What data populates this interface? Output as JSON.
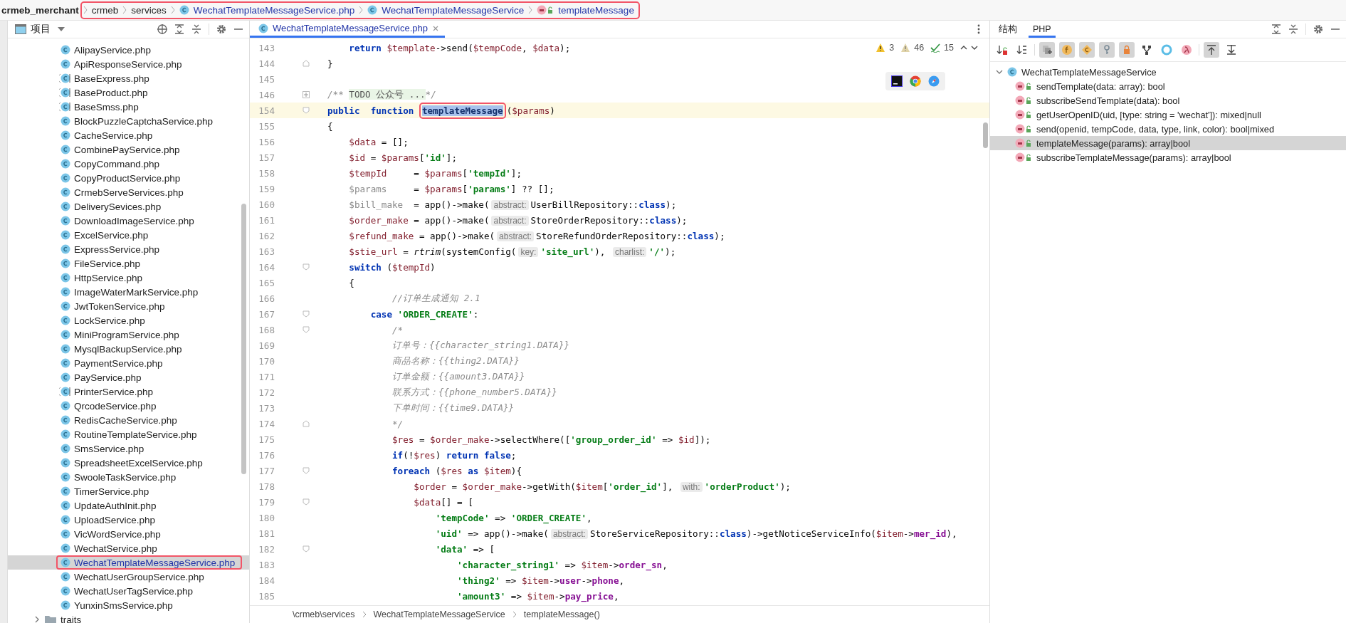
{
  "breadcrumb": {
    "project": "crmeb_merchant",
    "framed": true,
    "items": [
      {
        "label": "crmeb",
        "kind": "folder"
      },
      {
        "label": "services",
        "kind": "folder"
      },
      {
        "label": "WechatTemplateMessageService.php",
        "kind": "file"
      },
      {
        "label": "WechatTemplateMessageService",
        "kind": "class"
      },
      {
        "label": "templateMessage",
        "kind": "method"
      }
    ]
  },
  "project_panel": {
    "title": "项目",
    "files": [
      {
        "label": "AlipayService.php",
        "kind": "class",
        "selected": false,
        "annotated": false
      },
      {
        "label": "ApiResponseService.php",
        "kind": "class",
        "selected": false,
        "annotated": false
      },
      {
        "label": "BaseExpress.php",
        "kind": "abstract",
        "selected": false,
        "annotated": false
      },
      {
        "label": "BaseProduct.php",
        "kind": "abstract",
        "selected": false,
        "annotated": false
      },
      {
        "label": "BaseSmss.php",
        "kind": "abstract",
        "selected": false,
        "annotated": false
      },
      {
        "label": "BlockPuzzleCaptchaService.php",
        "kind": "class",
        "selected": false,
        "annotated": false
      },
      {
        "label": "CacheService.php",
        "kind": "class",
        "selected": false,
        "annotated": false
      },
      {
        "label": "CombinePayService.php",
        "kind": "class",
        "selected": false,
        "annotated": false
      },
      {
        "label": "CopyCommand.php",
        "kind": "class",
        "selected": false,
        "annotated": false
      },
      {
        "label": "CopyProductService.php",
        "kind": "class",
        "selected": false,
        "annotated": false
      },
      {
        "label": "CrmebServeServices.php",
        "kind": "class",
        "selected": false,
        "annotated": false
      },
      {
        "label": "DeliverySevices.php",
        "kind": "class",
        "selected": false,
        "annotated": false
      },
      {
        "label": "DownloadImageService.php",
        "kind": "class",
        "selected": false,
        "annotated": false
      },
      {
        "label": "ExcelService.php",
        "kind": "class",
        "selected": false,
        "annotated": false
      },
      {
        "label": "ExpressService.php",
        "kind": "class",
        "selected": false,
        "annotated": false
      },
      {
        "label": "FileService.php",
        "kind": "class",
        "selected": false,
        "annotated": false
      },
      {
        "label": "HttpService.php",
        "kind": "class",
        "selected": false,
        "annotated": false
      },
      {
        "label": "ImageWaterMarkService.php",
        "kind": "class",
        "selected": false,
        "annotated": false
      },
      {
        "label": "JwtTokenService.php",
        "kind": "class",
        "selected": false,
        "annotated": false
      },
      {
        "label": "LockService.php",
        "kind": "class",
        "selected": false,
        "annotated": false
      },
      {
        "label": "MiniProgramService.php",
        "kind": "class",
        "selected": false,
        "annotated": false
      },
      {
        "label": "MysqlBackupService.php",
        "kind": "class",
        "selected": false,
        "annotated": false
      },
      {
        "label": "PaymentService.php",
        "kind": "class",
        "selected": false,
        "annotated": false
      },
      {
        "label": "PayService.php",
        "kind": "class",
        "selected": false,
        "annotated": false
      },
      {
        "label": "PrinterService.php",
        "kind": "abstract",
        "selected": false,
        "annotated": false
      },
      {
        "label": "QrcodeService.php",
        "kind": "class",
        "selected": false,
        "annotated": false
      },
      {
        "label": "RedisCacheService.php",
        "kind": "class",
        "selected": false,
        "annotated": false
      },
      {
        "label": "RoutineTemplateService.php",
        "kind": "class",
        "selected": false,
        "annotated": false
      },
      {
        "label": "SmsService.php",
        "kind": "class",
        "selected": false,
        "annotated": false
      },
      {
        "label": "SpreadsheetExcelService.php",
        "kind": "class",
        "selected": false,
        "annotated": false
      },
      {
        "label": "SwooleTaskService.php",
        "kind": "class",
        "selected": false,
        "annotated": false
      },
      {
        "label": "TimerService.php",
        "kind": "class",
        "selected": false,
        "annotated": false
      },
      {
        "label": "UpdateAuthInit.php",
        "kind": "class",
        "selected": false,
        "annotated": false
      },
      {
        "label": "UploadService.php",
        "kind": "class",
        "selected": false,
        "annotated": false
      },
      {
        "label": "VicWordService.php",
        "kind": "class",
        "selected": false,
        "annotated": false
      },
      {
        "label": "WechatService.php",
        "kind": "class",
        "selected": false,
        "annotated": false
      },
      {
        "label": "WechatTemplateMessageService.php",
        "kind": "class",
        "selected": true,
        "annotated": true
      },
      {
        "label": "WechatUserGroupService.php",
        "kind": "class",
        "selected": false,
        "annotated": false
      },
      {
        "label": "WechatUserTagService.php",
        "kind": "class",
        "selected": false,
        "annotated": false
      },
      {
        "label": "YunxinSmsService.php",
        "kind": "class",
        "selected": false,
        "annotated": false
      }
    ],
    "folders": [
      {
        "label": "traits",
        "expanded": false
      }
    ]
  },
  "editor": {
    "tabs": [
      {
        "label": "WechatTemplateMessageService.php",
        "selected": true
      }
    ],
    "inspections": [
      {
        "kind": "warning",
        "count": "3"
      },
      {
        "kind": "weak",
        "count": "46"
      },
      {
        "kind": "typo",
        "count": "15"
      }
    ],
    "lines": [
      {
        "number": "143",
        "current": false,
        "tokens": [
          {
            "kind": "kw",
            "text": "    return "
          },
          {
            "kind": "var",
            "text": "$template"
          },
          {
            "kind": "plain",
            "text": "->send("
          },
          {
            "kind": "var",
            "text": "$tempCode"
          },
          {
            "kind": "plain",
            "text": ", "
          },
          {
            "kind": "var",
            "text": "$data"
          },
          {
            "kind": "plain",
            "text": ");"
          }
        ]
      },
      {
        "number": "144",
        "marker": {
          "kind": "end"
        },
        "current": false,
        "tokens": [
          {
            "kind": "plain",
            "text": "}"
          }
        ]
      },
      {
        "number": "145",
        "current": false
      },
      {
        "number": "146",
        "marker": {
          "kind": "collapsed"
        },
        "current": false,
        "tokens": [
          {
            "kind": "cmt",
            "text": "/** "
          },
          {
            "kind": "folded",
            "text": "TODO 公众号 ..."
          },
          {
            "kind": "cmt",
            "text": "*/"
          }
        ]
      },
      {
        "number": "154",
        "marker": {
          "kind": "start"
        },
        "current": true,
        "tokens": [
          {
            "kind": "kw",
            "text": "public  "
          },
          {
            "kind": "kw",
            "text": "function "
          },
          {
            "kind": "selection",
            "text": "templateMessage",
            "annotated": true
          },
          {
            "kind": "plain",
            "text": "("
          },
          {
            "kind": "var",
            "text": "$params"
          },
          {
            "kind": "plain",
            "text": ")"
          }
        ]
      },
      {
        "number": "155",
        "current": false,
        "tokens": [
          {
            "kind": "plain",
            "text": "{"
          }
        ]
      },
      {
        "number": "156",
        "current": false,
        "tokens": [
          {
            "kind": "var",
            "text": "    $data"
          },
          {
            "kind": "plain",
            "text": " = [];"
          }
        ]
      },
      {
        "number": "157",
        "current": false,
        "tokens": [
          {
            "kind": "var",
            "text": "    $id"
          },
          {
            "kind": "plain",
            "text": " = "
          },
          {
            "kind": "var",
            "text": "$params"
          },
          {
            "kind": "plain",
            "text": "["
          },
          {
            "kind": "str",
            "text": "'id'"
          },
          {
            "kind": "plain",
            "text": "];"
          }
        ]
      },
      {
        "number": "158",
        "current": false,
        "tokens": [
          {
            "kind": "var",
            "text": "    $tempId"
          },
          {
            "kind": "plain",
            "text": "     = "
          },
          {
            "kind": "var",
            "text": "$params"
          },
          {
            "kind": "plain",
            "text": "["
          },
          {
            "kind": "str",
            "text": "'tempId'"
          },
          {
            "kind": "plain",
            "text": "];"
          }
        ]
      },
      {
        "number": "159",
        "current": false,
        "tokens": [
          {
            "kind": "unused",
            "text": "    $params"
          },
          {
            "kind": "plain",
            "text": "     = "
          },
          {
            "kind": "var",
            "text": "$params"
          },
          {
            "kind": "plain",
            "text": "["
          },
          {
            "kind": "str",
            "text": "'params'"
          },
          {
            "kind": "plain",
            "text": "] ?? [];"
          }
        ]
      },
      {
        "number": "160",
        "current": false,
        "tokens": [
          {
            "kind": "unused",
            "text": "    $bill_make"
          },
          {
            "kind": "plain",
            "text": "  = app()->make("
          },
          {
            "kind": "hint",
            "text": "abstract:"
          },
          {
            "kind": "plain",
            "text": "UserBillRepository::"
          },
          {
            "kind": "kw",
            "text": "class"
          },
          {
            "kind": "plain",
            "text": ");"
          }
        ]
      },
      {
        "number": "161",
        "current": false,
        "tokens": [
          {
            "kind": "var",
            "text": "    $order_make"
          },
          {
            "kind": "plain",
            "text": " = app()->make("
          },
          {
            "kind": "hint",
            "text": "abstract:"
          },
          {
            "kind": "plain",
            "text": "StoreOrderRepository::"
          },
          {
            "kind": "kw",
            "text": "class"
          },
          {
            "kind": "plain",
            "text": ");"
          }
        ]
      },
      {
        "number": "162",
        "current": false,
        "tokens": [
          {
            "kind": "var",
            "text": "    $refund_make"
          },
          {
            "kind": "plain",
            "text": " = app()->make("
          },
          {
            "kind": "hint",
            "text": "abstract:"
          },
          {
            "kind": "plain",
            "text": "StoreRefundOrderRepository::"
          },
          {
            "kind": "kw",
            "text": "class"
          },
          {
            "kind": "plain",
            "text": ");"
          }
        ]
      },
      {
        "number": "163",
        "current": false,
        "tokens": [
          {
            "kind": "var",
            "text": "    $stie_url"
          },
          {
            "kind": "plain",
            "text": " = "
          },
          {
            "kind": "ital",
            "text": "rtrim"
          },
          {
            "kind": "plain",
            "text": "(systemConfig("
          },
          {
            "kind": "hint",
            "text": "key:"
          },
          {
            "kind": "str",
            "text": "'site_url'"
          },
          {
            "kind": "plain",
            "text": "), "
          },
          {
            "kind": "hint",
            "text": "charlist:"
          },
          {
            "kind": "str",
            "text": "'/'"
          },
          {
            "kind": "plain",
            "text": ");"
          }
        ]
      },
      {
        "number": "164",
        "marker": {
          "kind": "start"
        },
        "current": false,
        "tokens": [
          {
            "kind": "kw",
            "text": "    switch"
          },
          {
            "kind": "plain",
            "text": " ("
          },
          {
            "kind": "var",
            "text": "$tempId"
          },
          {
            "kind": "plain",
            "text": ")"
          }
        ]
      },
      {
        "number": "165",
        "current": false,
        "tokens": [
          {
            "kind": "plain",
            "text": "    {"
          }
        ]
      },
      {
        "number": "166",
        "current": false,
        "tokens": [
          {
            "kind": "cmt",
            "text": "            //订单生成通知 2.1"
          }
        ]
      },
      {
        "number": "167",
        "marker": {
          "kind": "start"
        },
        "current": false,
        "tokens": [
          {
            "kind": "kw",
            "text": "        case "
          },
          {
            "kind": "str",
            "text": "'ORDER_CREATE'"
          },
          {
            "kind": "plain",
            "text": ":"
          }
        ]
      },
      {
        "number": "168",
        "marker": {
          "kind": "start"
        },
        "current": false,
        "tokens": [
          {
            "kind": "cmt",
            "text": "            /*"
          }
        ]
      },
      {
        "number": "169",
        "current": false,
        "tokens": [
          {
            "kind": "cmt",
            "text": "            订单号：{{character_string1.DATA}}"
          }
        ]
      },
      {
        "number": "170",
        "current": false,
        "tokens": [
          {
            "kind": "cmt",
            "text": "            商品名称：{{thing2.DATA}}"
          }
        ]
      },
      {
        "number": "171",
        "current": false,
        "tokens": [
          {
            "kind": "cmt",
            "text": "            订单金额：{{amount3.DATA}}"
          }
        ]
      },
      {
        "number": "172",
        "current": false,
        "tokens": [
          {
            "kind": "cmt",
            "text": "            联系方式：{{phone_number5.DATA}}"
          }
        ]
      },
      {
        "number": "173",
        "current": false,
        "tokens": [
          {
            "kind": "cmt",
            "text": "            下单时间：{{time9.DATA}}"
          }
        ]
      },
      {
        "number": "174",
        "marker": {
          "kind": "end"
        },
        "current": false,
        "tokens": [
          {
            "kind": "cmt",
            "text": "            */"
          }
        ]
      },
      {
        "number": "175",
        "current": false,
        "tokens": [
          {
            "kind": "var",
            "text": "            $res"
          },
          {
            "kind": "plain",
            "text": " = "
          },
          {
            "kind": "var",
            "text": "$order_make"
          },
          {
            "kind": "plain",
            "text": "->selectWhere(["
          },
          {
            "kind": "str",
            "text": "'group_order_id'"
          },
          {
            "kind": "plain",
            "text": " => "
          },
          {
            "kind": "var",
            "text": "$id"
          },
          {
            "kind": "plain",
            "text": "]);"
          }
        ]
      },
      {
        "number": "176",
        "current": false,
        "tokens": [
          {
            "kind": "kw",
            "text": "            if"
          },
          {
            "kind": "plain",
            "text": "(!"
          },
          {
            "kind": "var",
            "text": "$res"
          },
          {
            "kind": "plain",
            "text": ") "
          },
          {
            "kind": "kw",
            "text": "return false"
          },
          {
            "kind": "plain",
            "text": ";"
          }
        ]
      },
      {
        "number": "177",
        "marker": {
          "kind": "start"
        },
        "current": false,
        "tokens": [
          {
            "kind": "kw",
            "text": "            foreach"
          },
          {
            "kind": "plain",
            "text": " ("
          },
          {
            "kind": "var",
            "text": "$res "
          },
          {
            "kind": "kw",
            "text": "as "
          },
          {
            "kind": "var",
            "text": "$item"
          },
          {
            "kind": "plain",
            "text": "){"
          }
        ]
      },
      {
        "number": "178",
        "current": false,
        "tokens": [
          {
            "kind": "var",
            "text": "                $order"
          },
          {
            "kind": "plain",
            "text": " = "
          },
          {
            "kind": "var",
            "text": "$order_make"
          },
          {
            "kind": "plain",
            "text": "->getWith("
          },
          {
            "kind": "var",
            "text": "$item"
          },
          {
            "kind": "plain",
            "text": "["
          },
          {
            "kind": "str",
            "text": "'order_id'"
          },
          {
            "kind": "plain",
            "text": "], "
          },
          {
            "kind": "hint",
            "text": "with:"
          },
          {
            "kind": "str",
            "text": "'orderProduct'"
          },
          {
            "kind": "plain",
            "text": ");"
          }
        ]
      },
      {
        "number": "179",
        "marker": {
          "kind": "start"
        },
        "current": false,
        "tokens": [
          {
            "kind": "var",
            "text": "                $data"
          },
          {
            "kind": "plain",
            "text": "[] = ["
          }
        ]
      },
      {
        "number": "180",
        "current": false,
        "tokens": [
          {
            "kind": "str",
            "text": "                    'tempCode'"
          },
          {
            "kind": "plain",
            "text": " => "
          },
          {
            "kind": "str",
            "text": "'ORDER_CREATE'"
          },
          {
            "kind": "plain",
            "text": ","
          }
        ]
      },
      {
        "number": "181",
        "current": false,
        "tokens": [
          {
            "kind": "str",
            "text": "                    'uid'"
          },
          {
            "kind": "plain",
            "text": " => app()->make("
          },
          {
            "kind": "hint",
            "text": "abstract:"
          },
          {
            "kind": "plain",
            "text": "StoreServiceRepository::"
          },
          {
            "kind": "kw",
            "text": "class"
          },
          {
            "kind": "plain",
            "text": ")->getNoticeServiceInfo("
          },
          {
            "kind": "var",
            "text": "$item"
          },
          {
            "kind": "plain",
            "text": "->"
          },
          {
            "kind": "field",
            "text": "mer_id"
          },
          {
            "kind": "plain",
            "text": "),"
          }
        ]
      },
      {
        "number": "182",
        "marker": {
          "kind": "start"
        },
        "current": false,
        "tokens": [
          {
            "kind": "str",
            "text": "                    'data'"
          },
          {
            "kind": "plain",
            "text": " => ["
          }
        ]
      },
      {
        "number": "183",
        "current": false,
        "tokens": [
          {
            "kind": "str",
            "text": "                        'character_string1'"
          },
          {
            "kind": "plain",
            "text": " => "
          },
          {
            "kind": "var",
            "text": "$item"
          },
          {
            "kind": "plain",
            "text": "->"
          },
          {
            "kind": "field",
            "text": "order_sn"
          },
          {
            "kind": "plain",
            "text": ","
          }
        ]
      },
      {
        "number": "184",
        "current": false,
        "tokens": [
          {
            "kind": "str",
            "text": "                        'thing2'"
          },
          {
            "kind": "plain",
            "text": " => "
          },
          {
            "kind": "var",
            "text": "$item"
          },
          {
            "kind": "plain",
            "text": "->"
          },
          {
            "kind": "field",
            "text": "user"
          },
          {
            "kind": "plain",
            "text": "->"
          },
          {
            "kind": "field",
            "text": "phone"
          },
          {
            "kind": "plain",
            "text": ","
          }
        ]
      },
      {
        "number": "185",
        "current": false,
        "tokens": [
          {
            "kind": "str",
            "text": "                        'amount3'"
          },
          {
            "kind": "plain",
            "text": " => "
          },
          {
            "kind": "var",
            "text": "$item"
          },
          {
            "kind": "plain",
            "text": "->"
          },
          {
            "kind": "field",
            "text": "pay_price"
          },
          {
            "kind": "plain",
            "text": ","
          }
        ]
      }
    ],
    "footer": [
      "\\crmeb\\services",
      "WechatTemplateMessageService",
      "templateMessage()"
    ]
  },
  "structure_panel": {
    "tabs": [
      {
        "label": "结构",
        "selected": false
      },
      {
        "label": "PHP",
        "selected": true
      }
    ],
    "toolbar": [
      {
        "kind": "sort-lock",
        "on": false
      },
      {
        "kind": "sort-az",
        "on": false
      },
      {
        "kind": "inherited",
        "on": true
      },
      {
        "kind": "fields",
        "on": true
      },
      {
        "kind": "constants",
        "on": true
      },
      {
        "kind": "key",
        "on": true
      },
      {
        "kind": "lock",
        "on": true
      },
      {
        "kind": "hierarchy",
        "on": false
      },
      {
        "kind": "traits",
        "on": false
      },
      {
        "kind": "lambda",
        "on": false
      },
      {
        "kind": "scroll-from",
        "on": true
      },
      {
        "kind": "scroll-to",
        "on": false
      }
    ],
    "root": {
      "label": "WechatTemplateMessageService",
      "expanded": true,
      "children": [
        {
          "label": "sendTemplate(data: array): bool",
          "selected": false
        },
        {
          "label": "subscribeSendTemplate(data): bool",
          "selected": false
        },
        {
          "label": "getUserOpenID(uid, [type: string = 'wechat']): mixed|null",
          "selected": false
        },
        {
          "label": "send(openid, tempCode, data, type, link, color): bool|mixed",
          "selected": false
        },
        {
          "label": "templateMessage(params): array|bool",
          "selected": true
        },
        {
          "label": "subscribeTemplateMessage(params): array|bool",
          "selected": false
        }
      ]
    }
  }
}
